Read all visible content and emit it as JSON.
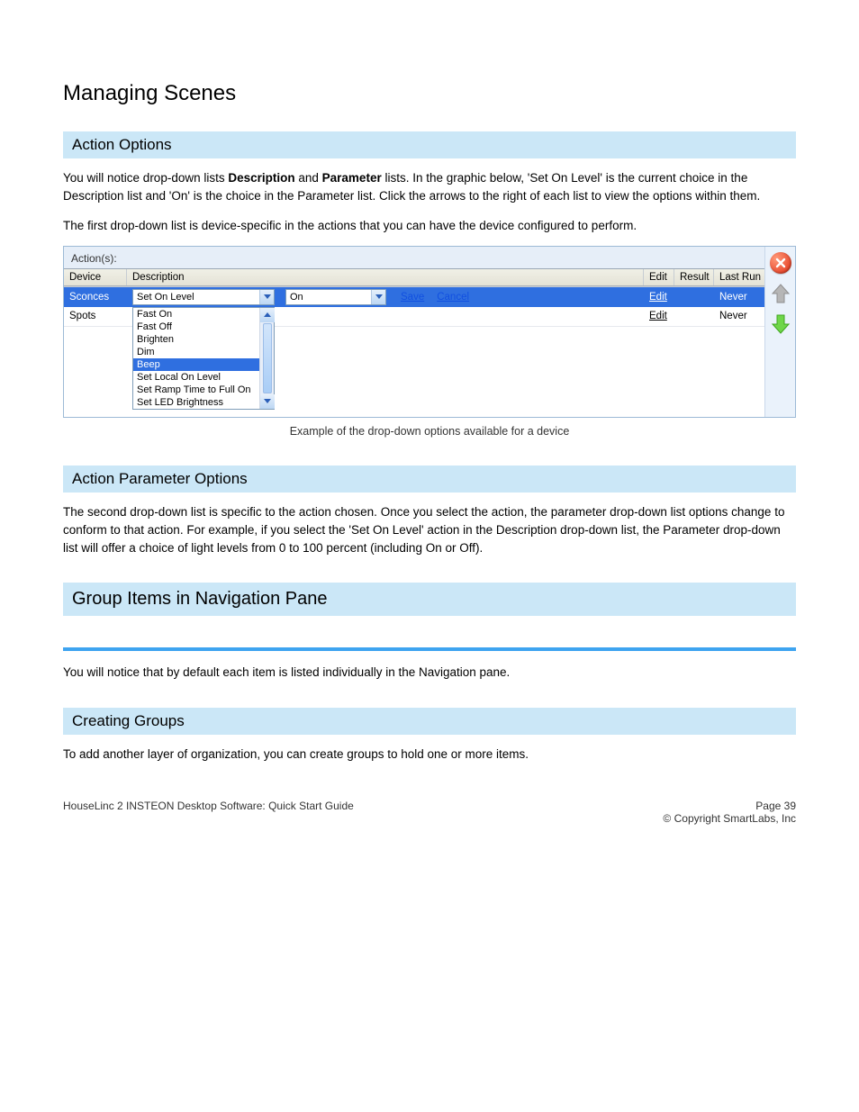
{
  "doc": {
    "page_title": "Managing Scenes",
    "sec_action_options": "Action Options",
    "action_options_p1_a": "You will notice drop-down lists ",
    "action_options_p1_b": "Description",
    "action_options_p1_c": " and ",
    "action_options_p1_d": "Parameter",
    "action_options_p1_e": " lists. In the graphic below, 'Set On Level' is the current choice in the Description list and 'On' is the choice in the Parameter list. Click the arrows to the right of each list to view the options within them.",
    "action_options_p2": "The first drop-down list is device-specific in the actions that you can have the device configured to perform.",
    "caption": "Example of the drop-down options available for a device",
    "sec_param": "Action Parameter Options",
    "param_p1": "The second drop-down list is specific to the action chosen. Once you select the action, the parameter drop-down list options change to conform to that action. For example, if you select the 'Set On Level' action in the Description drop-down list, the Parameter drop-down list will offer a choice of light levels from 0 to 100 percent (including On or Off).",
    "chapter": "Group Items in Navigation Pane",
    "chapter_sub": "You will notice that by default each item is listed individually in the Navigation pane.",
    "sec_create_groups": "Creating Groups",
    "create_groups_p": "To add another layer of organization, you can create groups to hold one or more items.",
    "footer_left": "HouseLinc 2 INSTEON Desktop Software: Quick Start Guide",
    "footer_right_a": "Page 39",
    "footer_right_b": "© Copyright SmartLabs, Inc"
  },
  "panel": {
    "actions_label": "Action(s):",
    "headers": {
      "device": "Device",
      "description": "Description",
      "edit": "Edit",
      "result": "Result",
      "lastrun": "Last Run"
    },
    "row1": {
      "device": "Sconces",
      "desc_combo": "Set On Level",
      "val_combo": "On",
      "save": "Save",
      "cancel": "Cancel",
      "edit": "Edit",
      "lastrun": "Never"
    },
    "row2": {
      "device": "Spots",
      "edit": "Edit",
      "lastrun": "Never"
    },
    "dropdown_items": [
      "Fast On",
      "Fast Off",
      "Brighten",
      "Dim",
      "Beep",
      "Set Local On Level",
      "Set Ramp Time to Full On",
      "Set LED Brightness"
    ],
    "dropdown_selected_index": 4
  }
}
